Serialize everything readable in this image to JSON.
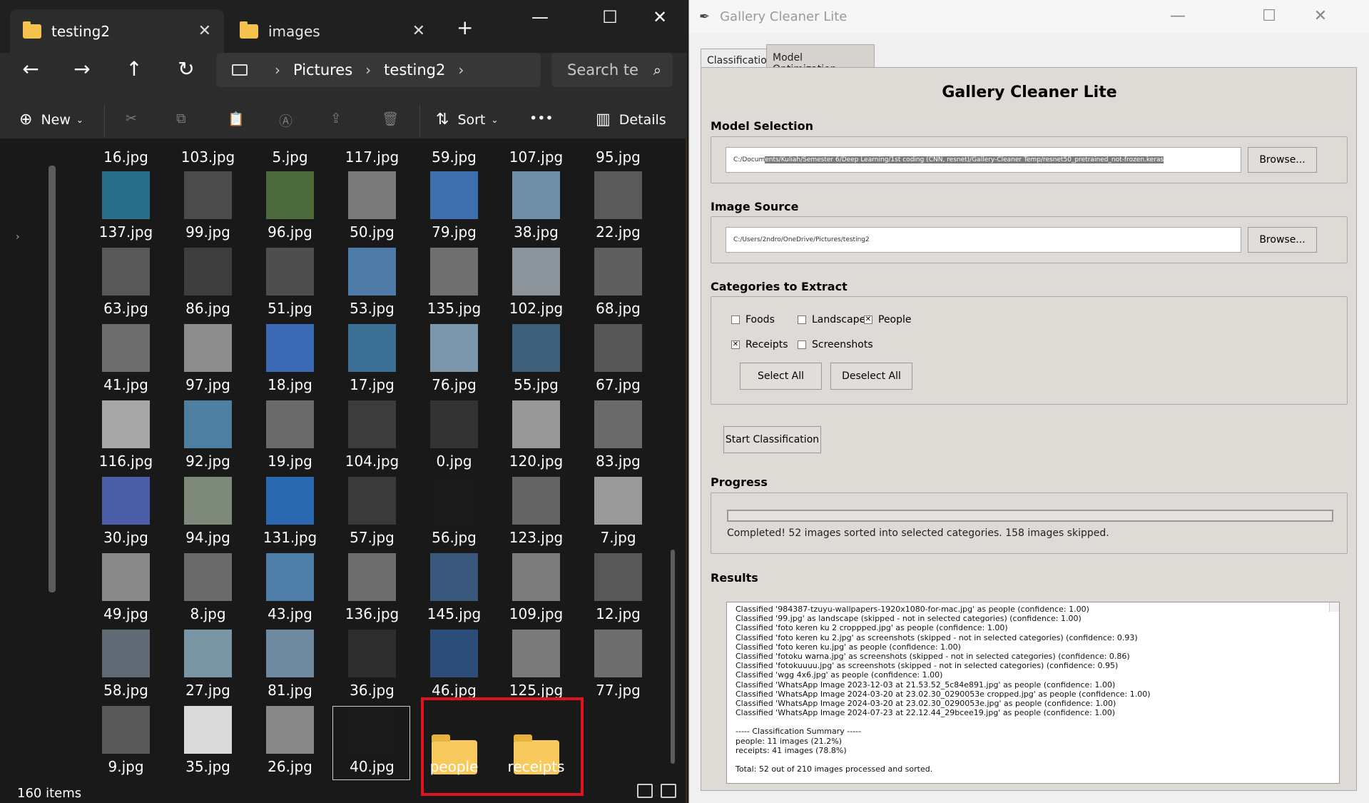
{
  "explorer": {
    "tabs": [
      {
        "label": "testing2"
      },
      {
        "label": "images"
      }
    ],
    "address": {
      "crumbs": [
        "Pictures",
        "testing2"
      ]
    },
    "search_placeholder": "Search te",
    "toolbar": {
      "new": "New",
      "sort": "Sort",
      "more": "•••",
      "details": "Details"
    },
    "files": [
      [
        "16.jpg",
        "103.jpg",
        "5.jpg",
        "117.jpg",
        "59.jpg",
        "107.jpg",
        "95.jpg"
      ],
      [
        "137.jpg",
        "99.jpg",
        "96.jpg",
        "50.jpg",
        "79.jpg",
        "38.jpg",
        "22.jpg"
      ],
      [
        "63.jpg",
        "86.jpg",
        "51.jpg",
        "53.jpg",
        "135.jpg",
        "102.jpg",
        "68.jpg"
      ],
      [
        "41.jpg",
        "97.jpg",
        "18.jpg",
        "17.jpg",
        "76.jpg",
        "55.jpg",
        "67.jpg"
      ],
      [
        "116.jpg",
        "92.jpg",
        "19.jpg",
        "104.jpg",
        "0.jpg",
        "120.jpg",
        "83.jpg"
      ],
      [
        "30.jpg",
        "94.jpg",
        "131.jpg",
        "57.jpg",
        "56.jpg",
        "123.jpg",
        "7.jpg"
      ],
      [
        "49.jpg",
        "8.jpg",
        "43.jpg",
        "136.jpg",
        "145.jpg",
        "109.jpg",
        "12.jpg"
      ],
      [
        "58.jpg",
        "27.jpg",
        "81.jpg",
        "36.jpg",
        "46.jpg",
        "125.jpg",
        "77.jpg"
      ],
      [
        "9.jpg",
        "35.jpg",
        "26.jpg",
        "40.jpg",
        "people",
        "receipts"
      ]
    ],
    "thumb_colors": [
      [
        "#2a6f8a",
        "#4b4b4b",
        "#4d6a3c",
        "#7a7a7a",
        "#3d6fae",
        "#6f8fa8",
        "#5a5a5a"
      ],
      [
        "#585858",
        "#3e3e3e",
        "#4e4e4e",
        "#4f7ba8",
        "#707070",
        "#8b949a",
        "#5f5f5f"
      ],
      [
        "#6d6d6d",
        "#8d8d8d",
        "#3b6ab5",
        "#3a6e92",
        "#7c96ac",
        "#3d5f7a",
        "#575757"
      ],
      [
        "#a7a7a7",
        "#4c7fa0",
        "#6a6a6a",
        "#3c3c3c",
        "#333333",
        "#989898",
        "#6a6a6a"
      ],
      [
        "#4d5ea8",
        "#7d8a7a",
        "#2a69b0",
        "#3a3a3a",
        "#1a1a1a",
        "#646464",
        "#9a9a9a"
      ],
      [
        "#8a8a8a",
        "#6a6a6a",
        "#4e7ea8",
        "#6d6d6d",
        "#3a587c",
        "#7c7c7c",
        "#585858"
      ],
      [
        "#5f6a74",
        "#7a95a4",
        "#6f8aa0",
        "#2e2e2e",
        "#2c4c7a",
        "#7a7a7a",
        "#6e6e6e"
      ],
      [
        "#585858",
        "#dadada",
        "#888888",
        "#1a1a1a"
      ]
    ],
    "status": "160 items"
  },
  "app": {
    "title": "Gallery Cleaner Lite",
    "tabs": [
      "Classification",
      "Model Optimization"
    ],
    "heading": "Gallery Cleaner Lite",
    "model": {
      "label": "Model Selection",
      "path_prefix": "C:/Docum",
      "path_selected": "ents/Kuliah/Semester 6/Deep Learning/1st coding (CNN, resnet)/Gallery-Cleaner Temp/resnet50_pretrained_not-frozen.keras",
      "browse": "Browse..."
    },
    "source": {
      "label": "Image Source",
      "path": "C:/Users/2ndro/OneDrive/Pictures/testing2",
      "browse": "Browse..."
    },
    "categories": {
      "label": "Categories to Extract",
      "items": [
        {
          "name": "Foods",
          "checked": false
        },
        {
          "name": "Landscape",
          "checked": false
        },
        {
          "name": "People",
          "checked": true
        },
        {
          "name": "Receipts",
          "checked": true
        },
        {
          "name": "Screenshots",
          "checked": false
        }
      ],
      "select_all": "Select All",
      "deselect_all": "Deselect All"
    },
    "start": "Start Classification",
    "progress": {
      "label": "Progress",
      "value": 1.0,
      "text": "Completed! 52 images sorted into selected categories. 158 images skipped."
    },
    "results": {
      "label": "Results",
      "lines": [
        "Classified '984387-tzuyu-wallpapers-1920x1080-for-mac.jpg' as people (confidence: 1.00)",
        "Classified '99.jpg' as landscape (skipped - not in selected categories) (confidence: 1.00)",
        "Classified 'foto keren ku 2 croppped.jpg' as people (confidence: 1.00)",
        "Classified 'foto keren ku 2.jpg' as screenshots (skipped - not in selected categories) (confidence: 0.93)",
        "Classified 'foto keren ku.jpg' as people (confidence: 1.00)",
        "Classified 'fotoku warna.jpg' as screenshots (skipped - not in selected categories) (confidence: 0.86)",
        "Classified 'fotokuuuu.jpg' as screenshots (skipped - not in selected categories) (confidence: 0.95)",
        "Classified 'wgg 4x6.jpg' as people (confidence: 1.00)",
        "Classified 'WhatsApp Image 2023-12-03 at 21.53.52_5c84e891.jpg' as people (confidence: 1.00)",
        "Classified 'WhatsApp Image 2024-03-20 at 23.02.30_0290053e cropped.jpg' as people (confidence: 1.00)",
        "Classified 'WhatsApp Image 2024-03-20 at 23.02.30_0290053e.jpg' as people (confidence: 1.00)",
        "Classified 'WhatsApp Image 2024-07-23 at 22.12.44_29bcee19.jpg' as people (confidence: 1.00)",
        "",
        "----- Classification Summary -----",
        "people: 11 images (21.2%)",
        "receipts: 41 images (78.8%)",
        "",
        "Total: 52 out of 210 images processed and sorted."
      ]
    }
  }
}
